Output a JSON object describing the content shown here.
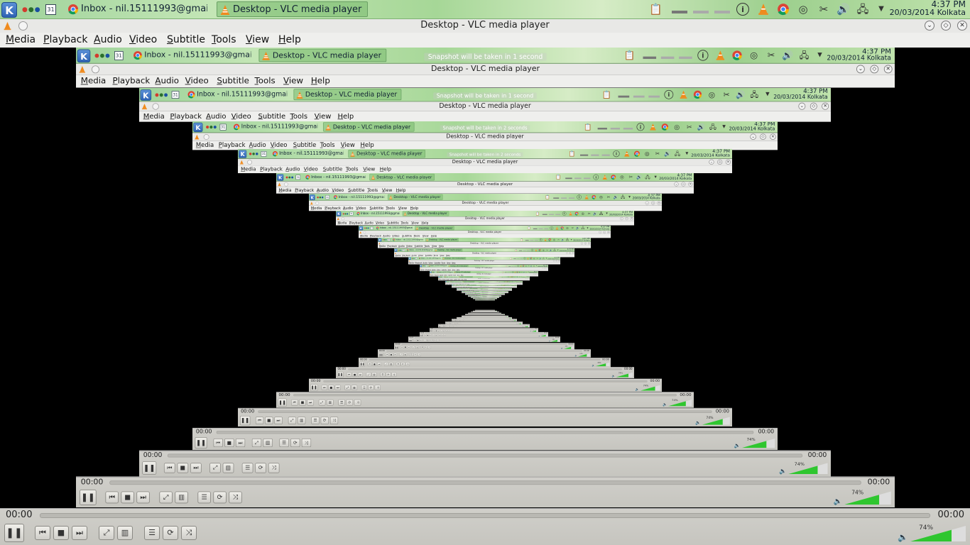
{
  "taskbar": {
    "kde_label": "K",
    "calendar_label": "31",
    "tasks": [
      {
        "label": "Inbox - nil.15111993@gmail."
      },
      {
        "label": "Desktop - VLC media player"
      }
    ],
    "tray_icons": [
      "clipboard-icon",
      "info-icon",
      "vlc-icon",
      "chrome-icon",
      "disk-icon",
      "scissors-icon",
      "volume-icon",
      "network-icon",
      "expand-icon"
    ],
    "clock_time": "4:37 PM",
    "clock_date": "20/03/2014 Kolkata"
  },
  "window": {
    "title": "Desktop - VLC media player",
    "controls": [
      "minimize",
      "maximize",
      "close"
    ]
  },
  "menu": [
    "Media",
    "Playback",
    "Audio",
    "Video",
    "Subtitle",
    "Tools",
    "View",
    "Help"
  ],
  "controls": {
    "time_elapsed": "00:00",
    "time_total": "00:00",
    "volume_label": "74%",
    "volume_level": 0.74,
    "buttons": [
      "pause",
      "previous",
      "stop",
      "next",
      "fullscreen",
      "extended-settings",
      "playlist",
      "loop",
      "random"
    ]
  },
  "snapshot_messages": [
    "Snapshot will be taken in 1 second",
    "Snapshot will be taken in 1 second",
    "Snapshot will be taken in 2 seconds",
    "Snapshot will be taken in 2 seconds"
  ],
  "colors": {
    "vlc_orange": "#f08a1c",
    "volume_green": "#2fc62f",
    "panel_green": "#a6d797"
  }
}
